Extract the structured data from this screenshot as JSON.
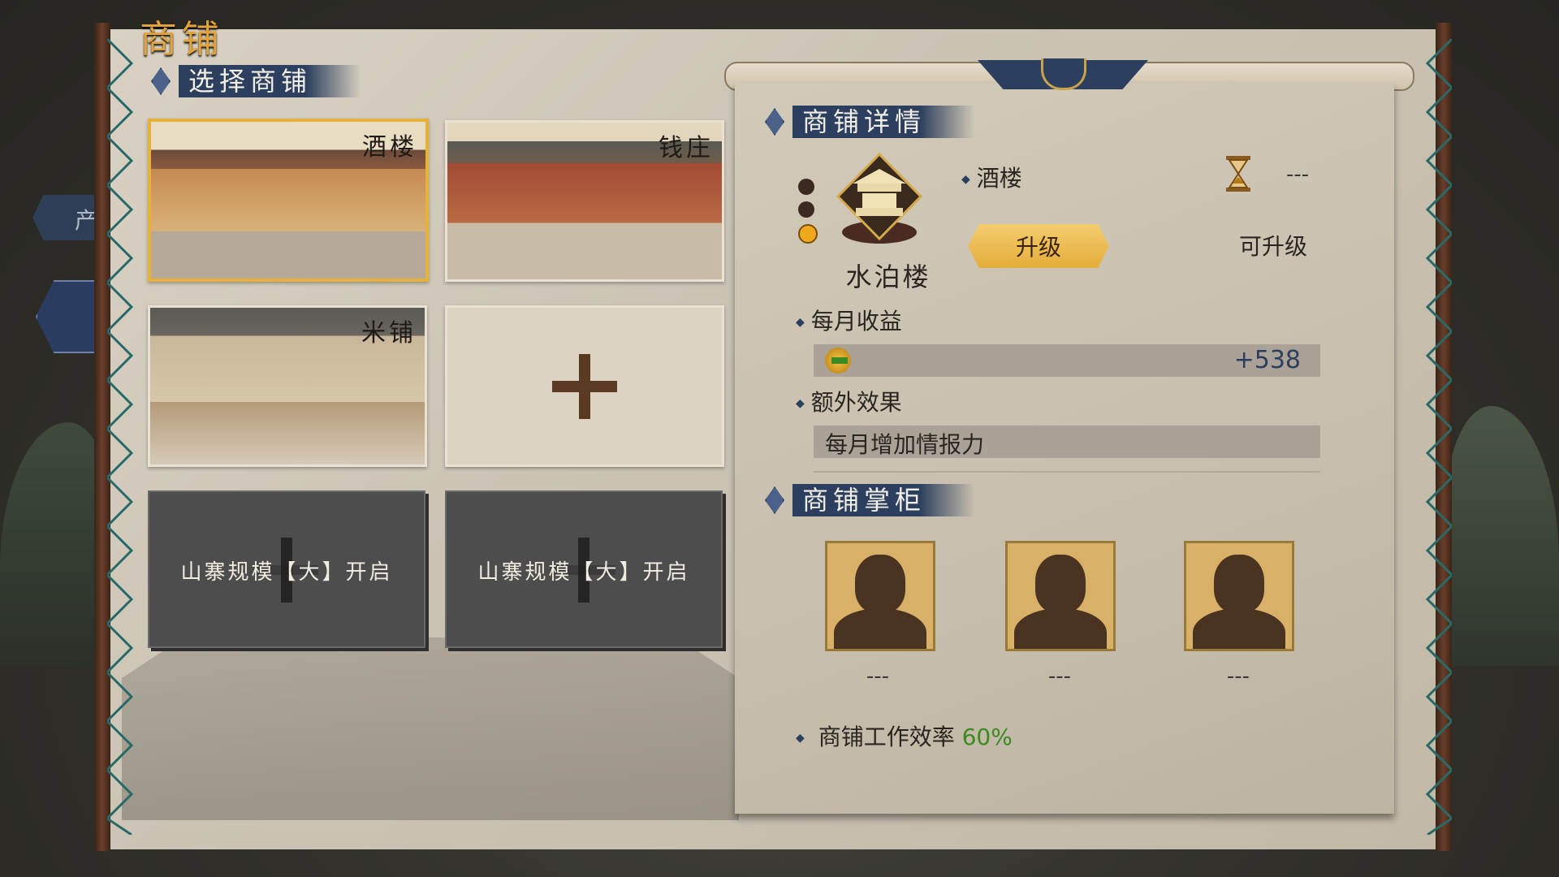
{
  "title": "商铺",
  "side_tab": "产",
  "select_section": {
    "header": "选择商铺",
    "cards": [
      {
        "label": "酒楼",
        "state": "selected"
      },
      {
        "label": "钱庄",
        "state": "owned"
      },
      {
        "label": "米铺",
        "state": "owned"
      },
      {
        "label": "",
        "state": "empty"
      }
    ],
    "locked": [
      {
        "text": "山寨规模【大】开启"
      },
      {
        "text": "山寨规模【大】开启"
      }
    ]
  },
  "detail": {
    "header": "商铺详情",
    "shop_type": "酒楼",
    "shop_name": "水泊楼",
    "time_value": "---",
    "upgrade_button": "升级",
    "upgrade_status": "可升级",
    "income_label": "每月收益",
    "income_value": "+538",
    "extra_label": "额外效果",
    "extra_value": "每月增加情报力",
    "level": {
      "current": 1,
      "max": 3
    }
  },
  "managers": {
    "header": "商铺掌柜",
    "slots": [
      {
        "name": "---"
      },
      {
        "name": "---"
      },
      {
        "name": "---"
      }
    ],
    "efficiency_label": "商铺工作效率",
    "efficiency_value": "60%"
  },
  "colors": {
    "accent_gold": "#e6b23a",
    "header_navy": "#2c3f5e",
    "efficiency_green": "#3c8a22"
  }
}
